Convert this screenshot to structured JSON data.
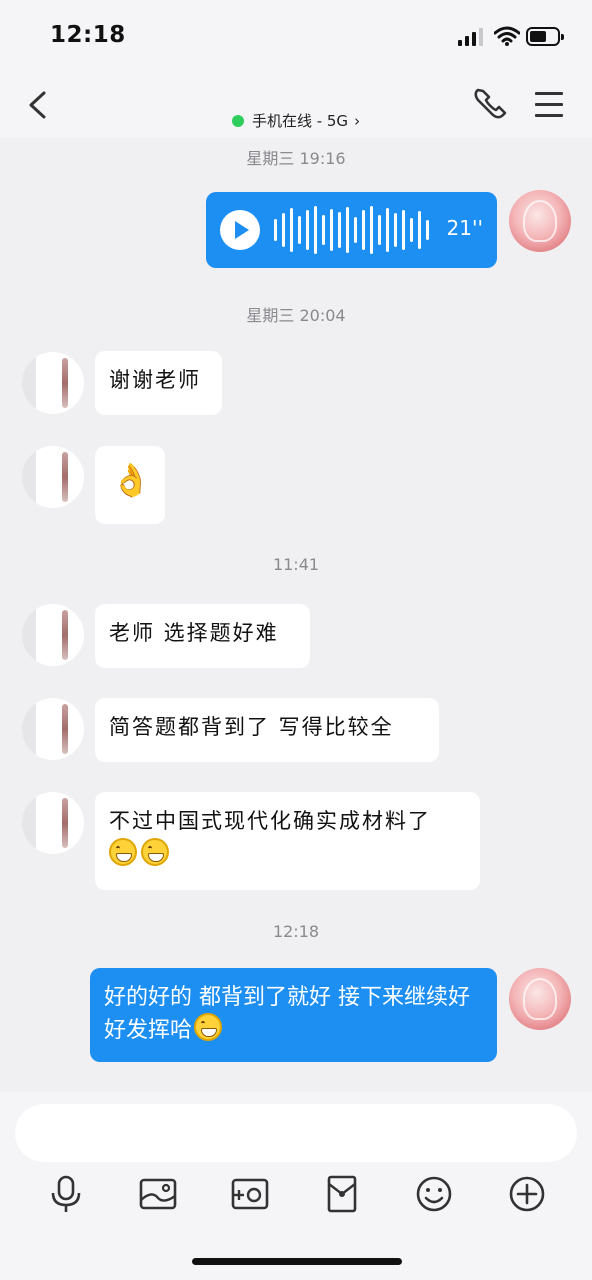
{
  "status_bar": {
    "time": "12:18"
  },
  "header": {
    "presence_text": "手机在线 - 5G"
  },
  "timestamps": [
    "星期三 19:16",
    "星期三 20:04",
    "11:41",
    "12:18"
  ],
  "voice_message": {
    "duration": "21''"
  },
  "messages": [
    {
      "from": "other",
      "text": "谢谢老师"
    },
    {
      "from": "other",
      "text": "👌"
    },
    {
      "from": "other",
      "text": "老师 选择题好难"
    },
    {
      "from": "other",
      "text": "简答题都背到了 写得比较全"
    },
    {
      "from": "other",
      "text": "不过中国式现代化确实成材料了"
    },
    {
      "from": "self",
      "text": "好的好的 都背到了就好 接下来继续好好发挥哈"
    }
  ],
  "colors": {
    "accent": "#1d8ff2",
    "online": "#2fcd5c",
    "background": "#f0eff2"
  },
  "icons": [
    "back-icon",
    "phone-icon",
    "menu-icon",
    "play-icon",
    "mic-icon",
    "image-icon",
    "camera-icon",
    "red-packet-icon",
    "emoji-icon",
    "plus-icon"
  ]
}
